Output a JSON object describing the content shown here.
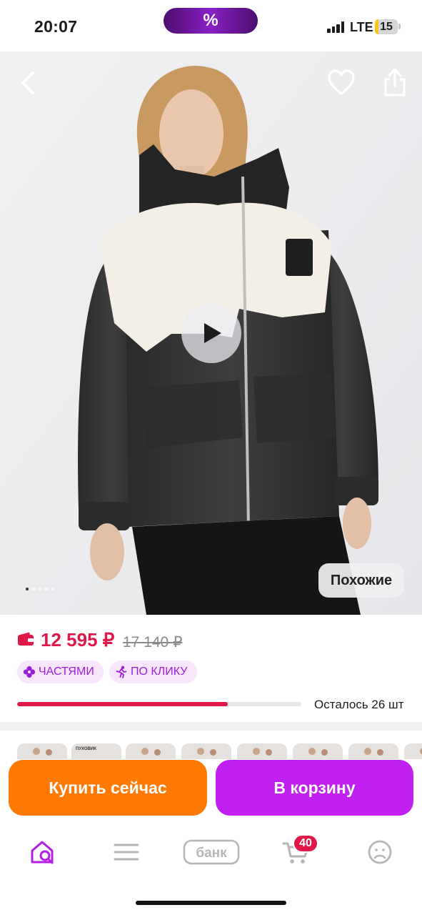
{
  "status_bar": {
    "time": "20:07",
    "promo_symbol": "%",
    "network": "LTE",
    "battery_level": "15",
    "battery_fraction": 0.15
  },
  "hero": {
    "similar_label": "Похожие",
    "image_count": 5,
    "active_image_index": 0,
    "icons": [
      "back-arrow-icon",
      "heart-icon",
      "share-icon",
      "play-icon"
    ]
  },
  "product": {
    "price": "12 595 ₽",
    "old_price": "17 140 ₽",
    "chip_parts_label": "ЧАСТЯМИ",
    "chip_click_label": "ПО КЛИКУ",
    "stock_text": "Осталось 26 шт",
    "stock_fraction": 0.74,
    "accent_color": "#e0184a",
    "chip_color": "#9c1fd6"
  },
  "thumbnails": {
    "first_label": "ПУХОВИК"
  },
  "actions": {
    "buy_now_label": "Купить сейчас",
    "add_to_cart_label": "В корзину",
    "buy_color": "#ff7a05",
    "cart_color": "#c020f0"
  },
  "bottom_nav": {
    "bank_label": "банк",
    "cart_count": "40",
    "items": [
      "home-search-icon",
      "catalog-icon",
      "bank-icon",
      "cart-icon",
      "profile-icon"
    ]
  }
}
